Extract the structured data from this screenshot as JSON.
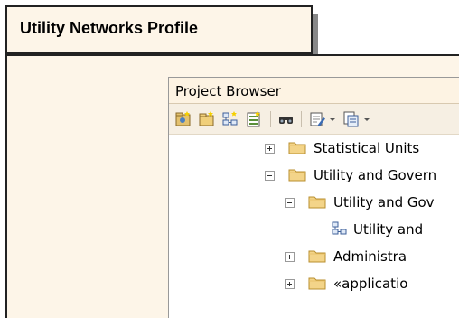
{
  "diagram": {
    "title": "Utility Networks Profile"
  },
  "project_browser": {
    "title": "Project Browser",
    "toolbar": [
      {
        "icon": "new-model-icon"
      },
      {
        "icon": "new-package-icon"
      },
      {
        "icon": "new-diagram-icon"
      },
      {
        "icon": "new-element-icon"
      },
      {
        "icon": "find-icon"
      },
      {
        "icon": "edit-note-icon"
      },
      {
        "icon": "dropdown-arrow-icon"
      },
      {
        "icon": "copy-icon"
      },
      {
        "icon": "dropdown-arrow-icon"
      }
    ],
    "tree": [
      {
        "label": "Statistical Units",
        "state": "collapsed",
        "type": "folder",
        "level": 0
      },
      {
        "label": "Utility and Govern",
        "state": "expanded",
        "type": "folder",
        "level": 0
      },
      {
        "label": "Utility and Gov",
        "state": "expanded",
        "type": "folder",
        "level": 1
      },
      {
        "label": "Utility and",
        "state": "none",
        "type": "diagram",
        "level": 2
      },
      {
        "label": "Administra",
        "state": "collapsed",
        "type": "folder",
        "level": 1
      },
      {
        "label": "«applicatio",
        "state": "collapsed",
        "type": "folder",
        "level": 1
      }
    ]
  }
}
